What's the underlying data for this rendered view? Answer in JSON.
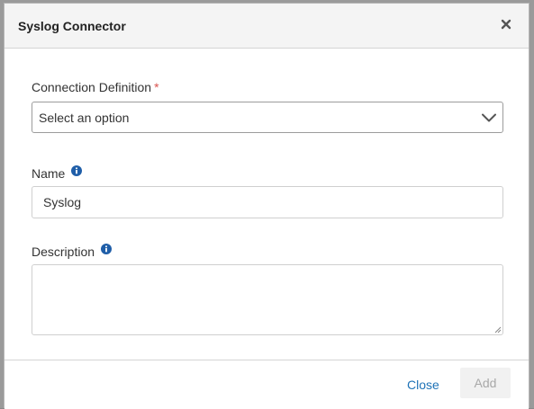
{
  "dialog": {
    "title": "Syslog Connector",
    "close_icon": "close-icon"
  },
  "form": {
    "connection_definition": {
      "label": "Connection Definition",
      "required_mark": "*",
      "value": "Select an option",
      "icon": "chevron-down-icon"
    },
    "name": {
      "label": "Name",
      "icon": "info-icon",
      "value": "Syslog"
    },
    "description": {
      "label": "Description",
      "icon": "info-icon",
      "value": ""
    }
  },
  "footer": {
    "close_label": "Close",
    "add_label": "Add"
  },
  "colors": {
    "link": "#1f73b7",
    "required": "#d9534f",
    "info": "#1f5ea8",
    "disabled_text": "#a8a8a8"
  }
}
